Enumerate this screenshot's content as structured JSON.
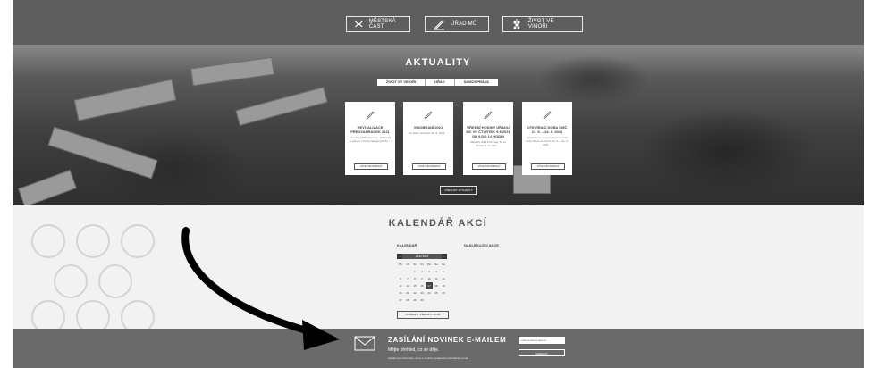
{
  "nav": {
    "items": [
      {
        "label": "MĚSTSKÁ ČÁST",
        "icon": "map-icon"
      },
      {
        "label": "ÚŘAD MČ",
        "icon": "pen-icon"
      },
      {
        "label": "ŽIVOT VE VINOŘI",
        "icon": "grapes-icon"
      }
    ]
  },
  "news": {
    "title": "AKTUALITY",
    "tabs": [
      "ŽIVOT VE VINOŘI",
      "ÚŘAD",
      "SAMOSPRÁVA"
    ],
    "cards": [
      {
        "title": "REVITALIZACE PŘEDZAHRÁDEK 2021",
        "text": "Vinořský ÚMČ informuje. Praha 19 je jedna z mnoha zapojených do ...",
        "button": "VÍCE INFORMACÍ"
      },
      {
        "title": "VINOBRANÍ 2021",
        "text": "Do 2021 vinobraní 11. 9. 2021 ...",
        "button": "VÍCE INFORMACÍ"
      },
      {
        "title": "ÚŘEDNÍ HODINY ÚŘADU MČ VE ČTVRTEK 9.9.2021 OD 9 DO 14 HODIN",
        "text": "Městský úřad informuje, že ve čtvrtek 9. 9. 2021 ...",
        "button": "VÍCE INFORMACÍ"
      },
      {
        "title": "OTEVÍRACÍ DOBA ÚMČ 13. 9. – 24. 9. 2021",
        "text": "Upozorňujeme na změnu otevírací doby úřadu ve dnech 13. 9. – 24. 9. 2021 ...",
        "button": "VÍCE INFORMACÍ"
      }
    ],
    "all_button": "VŠECHNY AKTUALITY"
  },
  "calendar": {
    "title": "KALENDÁŘ AKCÍ",
    "label_calendar": "KALENDÁŘ",
    "label_next": "NÁSLEDUJÍCÍ AKCE",
    "month": "ZÁŘÍ 2021",
    "prev": "‹",
    "next": "›",
    "weekdays": [
      "Po",
      "Út",
      "St",
      "Čt",
      "Pá",
      "So",
      "Ne"
    ],
    "days": [
      "",
      "",
      "1",
      "2",
      "3",
      "4",
      "5",
      "6",
      "7",
      "8",
      "9",
      "10",
      "11",
      "12",
      "13",
      "14",
      "15",
      "16",
      "17",
      "18",
      "19",
      "20",
      "21",
      "22",
      "23",
      "24",
      "25",
      "26",
      "27",
      "28",
      "29",
      "30",
      "",
      "",
      ""
    ],
    "today": "17",
    "all_button": "ZOBRAZIT VŠECHNY AKCE"
  },
  "footer": {
    "title": "ZASÍLÁNÍ NOVINEK E-MAILEM",
    "subtitle": "Mějte přehled, co se děje.",
    "small": "Zasílat tyto informace, akce a novinky, opakování pravidelně e-mail.",
    "email_placeholder": "Váš emailová adresa",
    "submit": "ODESLAT"
  }
}
